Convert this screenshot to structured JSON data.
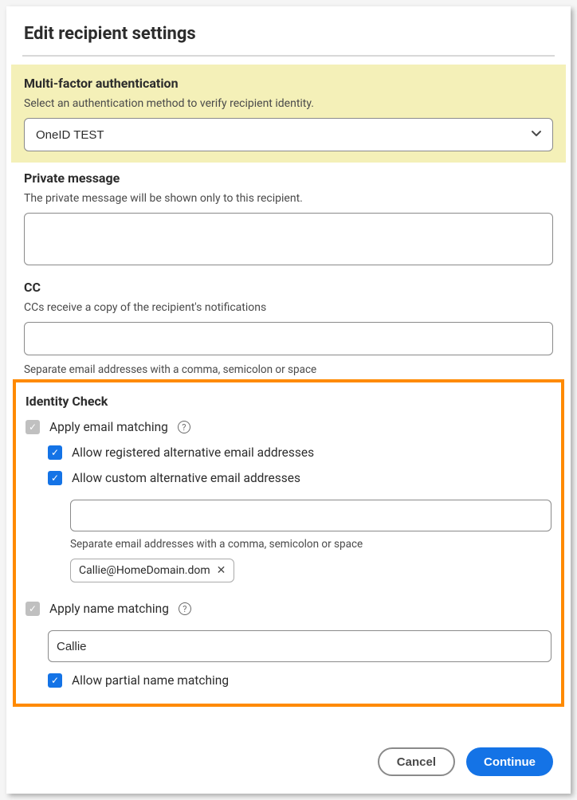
{
  "header": {
    "title": "Edit recipient settings"
  },
  "mfa": {
    "title": "Multi-factor authentication",
    "desc": "Select an authentication method to verify recipient identity.",
    "selected": "OneID TEST"
  },
  "privateMessage": {
    "title": "Private message",
    "desc": "The private message will be shown only to this recipient.",
    "value": ""
  },
  "cc": {
    "title": "CC",
    "desc": "CCs receive a copy of the recipient's notifications",
    "value": "",
    "helper": "Separate email addresses with a comma, semicolon or space"
  },
  "identity": {
    "title": "Identity Check",
    "emailMatching": {
      "label": "Apply email matching",
      "checked": true,
      "allowRegistered": {
        "label": "Allow registered alternative email addresses",
        "checked": true
      },
      "allowCustom": {
        "label": "Allow custom alternative email addresses",
        "checked": true,
        "inputValue": "",
        "helper": "Separate email addresses with a comma, semicolon or space",
        "chips": [
          "Callie@HomeDomain.dom"
        ]
      }
    },
    "nameMatching": {
      "label": "Apply name matching",
      "checked": true,
      "value": "Callie",
      "allowPartial": {
        "label": "Allow partial name matching",
        "checked": true
      }
    }
  },
  "footer": {
    "cancel": "Cancel",
    "continue": "Continue"
  }
}
